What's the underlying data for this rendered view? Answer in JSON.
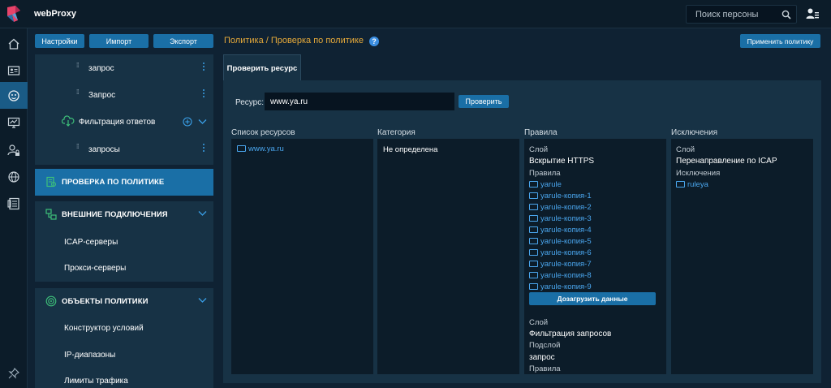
{
  "app": {
    "title": "webProxy"
  },
  "search": {
    "placeholder": "Поиск персоны"
  },
  "toolbar": {
    "settings": "Настройки",
    "import": "Импорт",
    "export": "Экспорт",
    "apply": "Применить политику"
  },
  "breadcrumb": "Политика / Проверка по политике",
  "help": "?",
  "tree": [
    {
      "label": "запрос",
      "type": "rule"
    },
    {
      "label": "Запрос",
      "type": "rule"
    },
    {
      "label": "Фильтрация ответов",
      "type": "layer"
    },
    {
      "label": "запросы",
      "type": "rule"
    }
  ],
  "nav": {
    "policy_check": "ПРОВЕРКА ПО ПОЛИТИКЕ",
    "external": {
      "label": "ВНЕШНИЕ ПОДКЛЮЧЕНИЯ",
      "items": [
        "ICAP-серверы",
        "Прокси-серверы"
      ]
    },
    "objects": {
      "label": "ОБЪЕКТЫ ПОЛИТИКИ",
      "items": [
        "Конструктор условий",
        "IP-диапазоны",
        "Лимиты трафика"
      ]
    }
  },
  "tab": {
    "label": "Проверить ресурс"
  },
  "resource": {
    "label": "Ресурс:",
    "value": "www.ya.ru",
    "check_button": "Проверить"
  },
  "columns": {
    "resources": {
      "title": "Список ресурсов",
      "items": [
        "www.ya.ru"
      ]
    },
    "category": {
      "title": "Категория",
      "value": "Не определена"
    },
    "rules": {
      "title": "Правила",
      "layer_label": "Слой",
      "layer1": "Вскрытие HTTPS",
      "rules_label": "Правила",
      "rules": [
        "yarule",
        "yarule-копия-1",
        "yarule-копия-2",
        "yarule-копия-3",
        "yarule-копия-4",
        "yarule-копия-5",
        "yarule-копия-6",
        "yarule-копия-7",
        "yarule-копия-8",
        "yarule-копия-9"
      ],
      "load_more": "Дозагрузить данные",
      "layer2": "Фильтрация запросов",
      "sublayer_label": "Подслой",
      "sublayer": "запрос",
      "rules_label2": "Правила"
    },
    "exceptions": {
      "title": "Исключения",
      "layer_label": "Слой",
      "layer": "Перенаправление по ICAP",
      "exceptions_label": "Исключения",
      "items": [
        "ruleya"
      ]
    }
  },
  "colors": {
    "accent": "#1a6fa6",
    "breadcrumb": "#e5a93a",
    "link": "#4aa6ee",
    "active_nav": "#1a5b86"
  },
  "icons": [
    "home-icon",
    "id-card-icon",
    "policy-icon",
    "monitor-chart-icon",
    "user-lock-icon",
    "globe-icon",
    "log-icon",
    "pin-icon",
    "search-icon",
    "user-list-icon"
  ]
}
